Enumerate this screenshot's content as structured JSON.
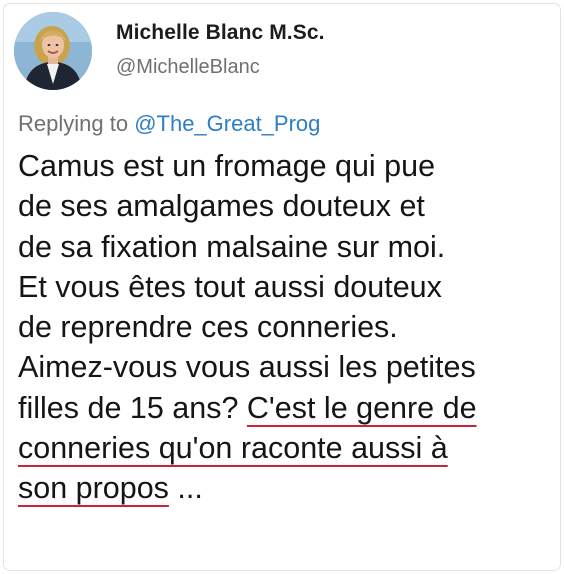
{
  "profile": {
    "display_name": "Michelle Blanc M.Sc.",
    "handle": "@MichelleBlanc",
    "avatar_icon": "user-avatar"
  },
  "reply": {
    "prefix": "Replying to ",
    "mention": "@The_Great_Prog"
  },
  "tweet": {
    "lines": [
      "Camus est un fromage qui pue",
      "de ses amalgames douteux et",
      "de sa fixation malsaine sur moi.",
      "Et vous êtes tout aussi douteux",
      "de reprendre ces conneries.",
      "Aimez-vous vous aussi les petites"
    ],
    "line7_plain": "filles de 15 ans? ",
    "line7_underlined": "C'est le genre de",
    "line8_underlined": "conneries qu'on raconte aussi à",
    "line9_underlined": "son propos",
    "line9_suffix": " ..."
  },
  "colors": {
    "name_text": "#1c1c1c",
    "secondary_text": "#707070",
    "mention_link": "#2d7fc4",
    "underline_mark": "#c4253b",
    "body_text": "#151515"
  }
}
